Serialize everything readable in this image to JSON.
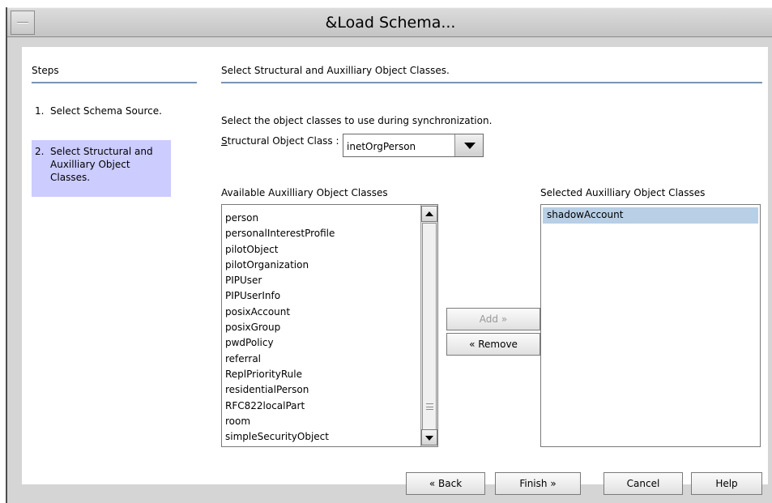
{
  "window": {
    "title": "&Load Schema..."
  },
  "steps": {
    "header": "Steps",
    "items": [
      {
        "num": "1.",
        "label": "Select Schema Source."
      },
      {
        "num": "2.",
        "label": "Select Structural and Auxilliary Object Classes."
      }
    ]
  },
  "main": {
    "header": "Select Structural and Auxilliary Object Classes.",
    "instruction": "Select the object classes to use during synchronization.",
    "structural_label": "Structural Object Class :",
    "structural_value": "inetOrgPerson",
    "available_label": "Available Auxilliary Object Classes",
    "selected_label": "Selected Auxilliary Object Classes",
    "available_items": [
      "person",
      "personalInterestProfile",
      "pilotObject",
      "pilotOrganization",
      "PIPUser",
      "PIPUserInfo",
      "posixAccount",
      "posixGroup",
      "pwdPolicy",
      "referral",
      "ReplPriorityRule",
      "residentialPerson",
      "RFC822localPart",
      "room",
      "simpleSecurityObject"
    ],
    "selected_items": [
      "shadowAccount"
    ],
    "add_label": "Add",
    "remove_label": "Remove"
  },
  "footer": {
    "back": "Back",
    "finish": "Finish",
    "cancel": "Cancel",
    "help": "Help"
  }
}
